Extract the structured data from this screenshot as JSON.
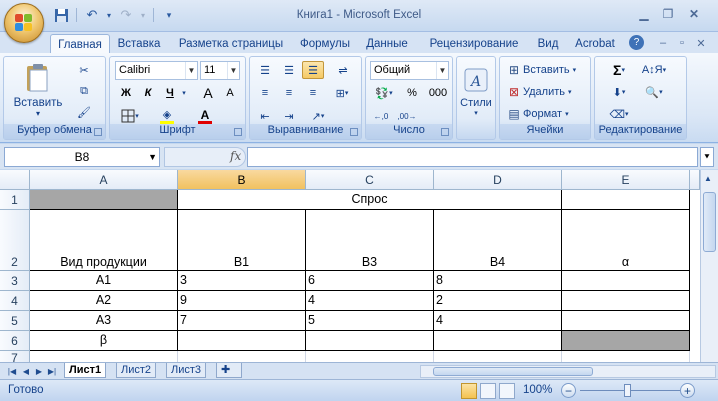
{
  "window": {
    "title": "Книга1 - Microsoft Excel",
    "controls": [
      "minimize-icon",
      "restore-icon",
      "close-icon"
    ]
  },
  "qat": {
    "items": [
      "save-icon",
      "undo-icon",
      "redo-icon",
      "customize-icon"
    ]
  },
  "tabs": [
    "Главная",
    "Вставка",
    "Разметка страницы",
    "Формулы",
    "Данные",
    "Рецензирование",
    "Вид",
    "Acrobat"
  ],
  "active_tab": "Главная",
  "ribbon": {
    "clipboard": {
      "label": "Буфер обмена",
      "paste": "Вставить"
    },
    "font": {
      "label": "Шрифт",
      "name": "Calibri",
      "size": "11",
      "bold": "Ж",
      "italic": "К",
      "underline": "Ч",
      "grow": "A",
      "shrink": "A",
      "font_color_letter": "A"
    },
    "alignment": {
      "label": "Выравнивание"
    },
    "number": {
      "label": "Число",
      "format": "Общий",
      "percent": "%",
      "thousands": "000"
    },
    "styles": {
      "label": "Стили"
    },
    "cells": {
      "label": "Ячейки",
      "insert": "Вставить",
      "delete": "Удалить",
      "format": "Формат"
    },
    "editing": {
      "label": "Редактирование",
      "sum": "Σ"
    }
  },
  "formula_bar": {
    "name_box": "B8",
    "fx": "fx",
    "content": ""
  },
  "columns": [
    "A",
    "B",
    "C",
    "D",
    "E"
  ],
  "selected_column": "B",
  "rows": [
    "1",
    "2",
    "3",
    "4",
    "5",
    "6",
    "7"
  ],
  "cells": {
    "B1": "Спрос",
    "A2": "Вид продукции",
    "B2": "В1",
    "C2": "В3",
    "D2": "В4",
    "E2": "α",
    "A3": "А1",
    "B3": "3",
    "C3": "6",
    "D3": "8",
    "A4": "А2",
    "B4": "9",
    "C4": "4",
    "D4": "2",
    "A5": "А3",
    "B5": "7",
    "C5": "5",
    "D5": "4",
    "A6": "β"
  },
  "sheets": [
    "Лист1",
    "Лист2",
    "Лист3"
  ],
  "active_sheet": "Лист1",
  "status": {
    "ready": "Готово",
    "zoom": "100%",
    "zoom_percent": 100
  }
}
